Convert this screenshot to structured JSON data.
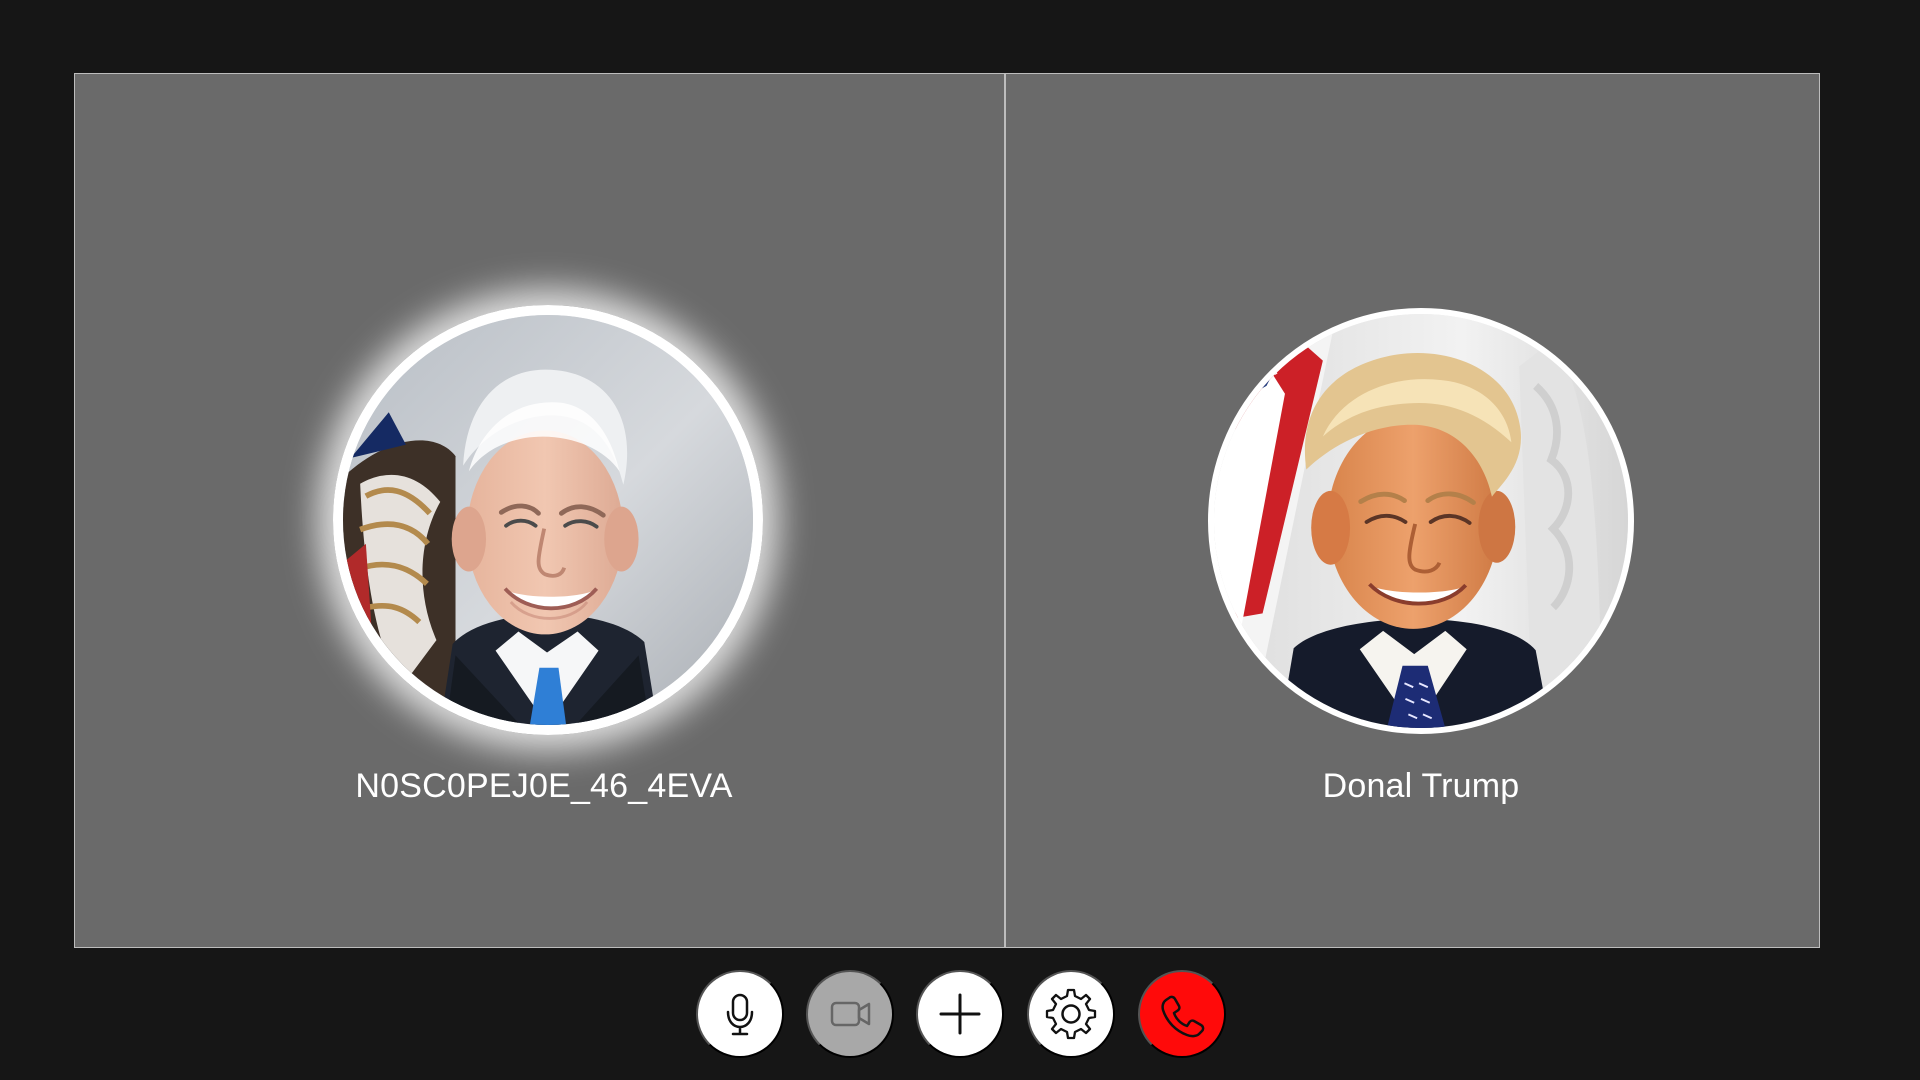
{
  "participants": [
    {
      "name": "N0SC0PEJ0E_46_4EVA",
      "avatar": "smiling-man-with-white-hair-portrait"
    },
    {
      "name": "Donal Trump",
      "avatar": "smiling-man-with-blond-hair-portrait"
    }
  ],
  "controls": [
    {
      "icon": "microphone-icon"
    },
    {
      "icon": "video-camera-icon"
    },
    {
      "icon": "plus-icon"
    },
    {
      "icon": "gear-icon"
    },
    {
      "icon": "phone-icon"
    }
  ],
  "colors": {
    "background": "#161616",
    "tile": "#6a6a6a",
    "button_default": "#ffffff",
    "button_muted": "#a8a8a8",
    "end_call": "#ff0a0a"
  }
}
